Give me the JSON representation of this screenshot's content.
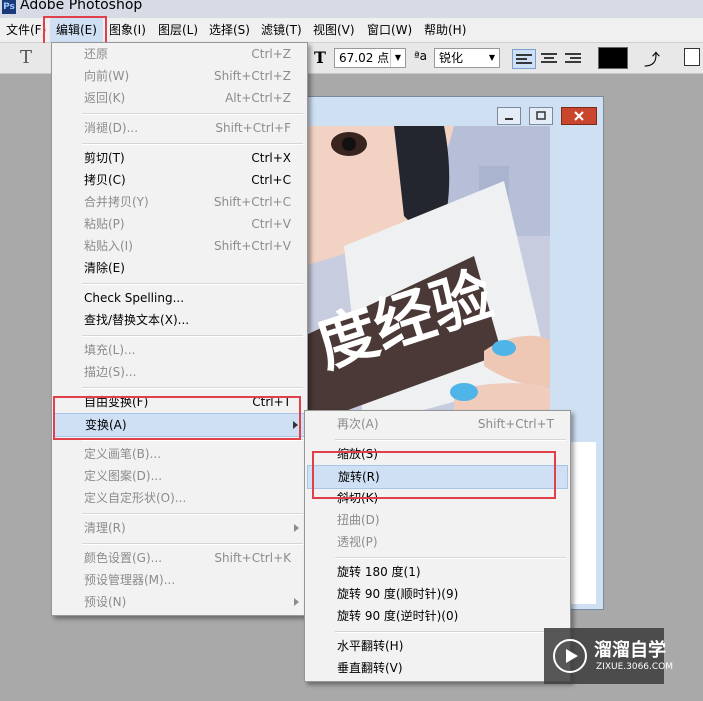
{
  "window": {
    "title": "Adobe Photoshop"
  },
  "menubar": {
    "items": [
      "文件(F)",
      "编辑(E)",
      "图象(I)",
      "图层(L)",
      "选择(S)",
      "滤镜(T)",
      "视图(V)",
      "窗口(W)",
      "帮助(H)"
    ]
  },
  "options": {
    "font_size_value": "67.02 点",
    "aa_label": "ªa",
    "antialias_value": "锐化"
  },
  "edit_menu": {
    "items": [
      {
        "label": "还原",
        "shortcut": "Ctrl+Z"
      },
      {
        "label": "向前(W)",
        "shortcut": "Shift+Ctrl+Z"
      },
      {
        "label": "返回(K)",
        "shortcut": "Alt+Ctrl+Z"
      },
      {
        "label": "消褪(D)...",
        "shortcut": "Shift+Ctrl+F"
      },
      {
        "label": "剪切(T)",
        "shortcut": "Ctrl+X"
      },
      {
        "label": "拷贝(C)",
        "shortcut": "Ctrl+C"
      },
      {
        "label": "合并拷贝(Y)",
        "shortcut": "Shift+Ctrl+C"
      },
      {
        "label": "粘贴(P)",
        "shortcut": "Ctrl+V"
      },
      {
        "label": "粘贴入(I)",
        "shortcut": "Shift+Ctrl+V"
      },
      {
        "label": "清除(E)",
        "shortcut": ""
      },
      {
        "label": "Check Spelling...",
        "shortcut": ""
      },
      {
        "label": "查找/替换文本(X)...",
        "shortcut": ""
      },
      {
        "label": "填充(L)...",
        "shortcut": ""
      },
      {
        "label": "描边(S)...",
        "shortcut": ""
      },
      {
        "label": "自由变换(F)",
        "shortcut": "Ctrl+T"
      },
      {
        "label": "变换(A)",
        "shortcut": ""
      },
      {
        "label": "定义画笔(B)...",
        "shortcut": ""
      },
      {
        "label": "定义图案(D)...",
        "shortcut": ""
      },
      {
        "label": "定义自定形状(O)...",
        "shortcut": ""
      },
      {
        "label": "清理(R)",
        "shortcut": ""
      },
      {
        "label": "颜色设置(G)...",
        "shortcut": "Shift+Ctrl+K"
      },
      {
        "label": "预设管理器(M)...",
        "shortcut": ""
      },
      {
        "label": "预设(N)",
        "shortcut": ""
      }
    ]
  },
  "transform_menu": {
    "items": [
      {
        "label": "再次(A)",
        "shortcut": "Shift+Ctrl+T"
      },
      {
        "label": "缩放(S)",
        "shortcut": ""
      },
      {
        "label": "旋转(R)",
        "shortcut": ""
      },
      {
        "label": "斜切(K)",
        "shortcut": ""
      },
      {
        "label": "扭曲(D)",
        "shortcut": ""
      },
      {
        "label": "透视(P)",
        "shortcut": ""
      },
      {
        "label": "旋转 180 度(1)",
        "shortcut": ""
      },
      {
        "label": "旋转 90 度(顺时针)(9)",
        "shortcut": ""
      },
      {
        "label": "旋转 90 度(逆时针)(0)",
        "shortcut": ""
      },
      {
        "label": "水平翻转(H)",
        "shortcut": ""
      },
      {
        "label": "垂直翻转(V)",
        "shortcut": ""
      }
    ]
  },
  "canvas": {
    "text": "度经验"
  },
  "watermark": {
    "brand": "溜溜自学",
    "url": "ZIXUE.3066.COM"
  },
  "colors": {
    "highlight": "#cfe0f4",
    "annotation_red": "#e0404a"
  }
}
